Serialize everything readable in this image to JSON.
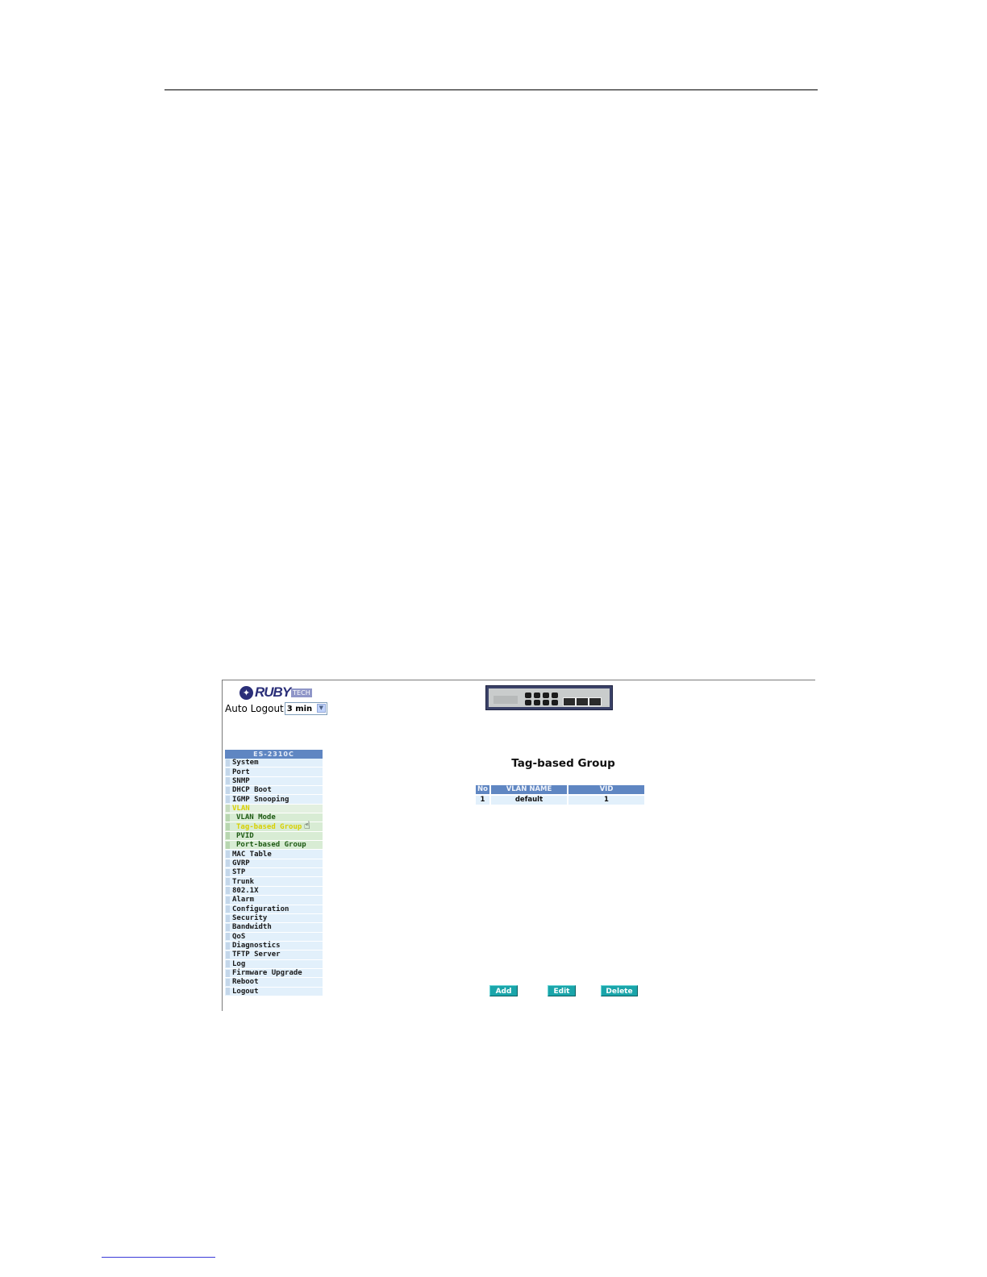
{
  "header": {
    "auto_logout_label": "Auto Logout",
    "auto_logout_value": "3 min"
  },
  "logo": {
    "text": "RUBY",
    "tail": "TECH"
  },
  "menu": {
    "title": "ES-2310C",
    "items": [
      "System",
      "Port",
      "SNMP",
      "DHCP Boot",
      "IGMP Snooping",
      "VLAN",
      "VLAN Mode",
      "Tag-based Group",
      "PVID",
      "Port-based Group",
      "MAC Table",
      "GVRP",
      "STP",
      "Trunk",
      "802.1X",
      "Alarm",
      "Configuration",
      "Security",
      "Bandwidth",
      "QoS",
      "Diagnostics",
      "TFTP Server",
      "Log",
      "Firmware Upgrade",
      "Reboot",
      "Logout"
    ]
  },
  "main": {
    "title": "Tag-based Group",
    "table": {
      "headers": [
        "No",
        "VLAN NAME",
        "VID"
      ],
      "rows": [
        [
          "1",
          "default",
          "1"
        ]
      ]
    },
    "buttons": {
      "add": "Add",
      "edit": "Edit",
      "delete": "Delete"
    }
  },
  "colors": {
    "menu_header": "#5f86c2",
    "menu_item": "#e2f0fb",
    "active_item": "#d8d000",
    "button": "#1aa5aa"
  }
}
